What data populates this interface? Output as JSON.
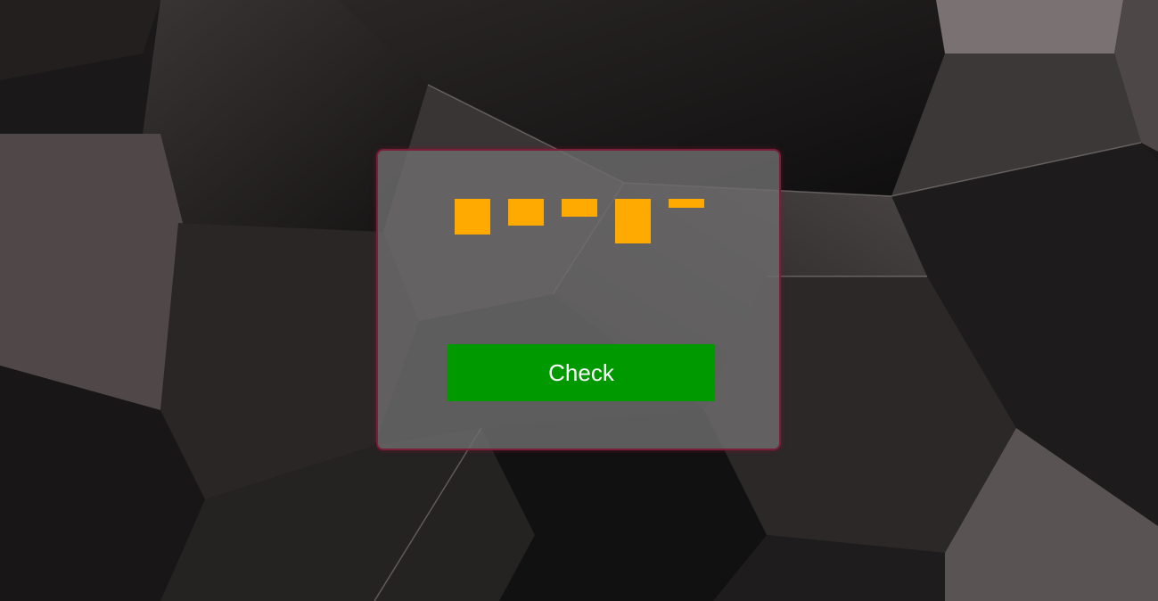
{
  "colors": {
    "background": "#1c1a1a",
    "panel_border": "#7a1f38",
    "bar": "#ffaa00",
    "button": "#009900",
    "button_text": "#ffffff"
  },
  "captcha": {
    "bar_levels": [
      {
        "top": 0,
        "height": 1.0
      },
      {
        "top": 0,
        "height": 0.75
      },
      {
        "top": 0,
        "height": 0.5
      },
      {
        "top": 0,
        "height": 1.25
      },
      {
        "top": 0,
        "height": 0.25
      }
    ]
  },
  "button": {
    "label": "Check"
  }
}
